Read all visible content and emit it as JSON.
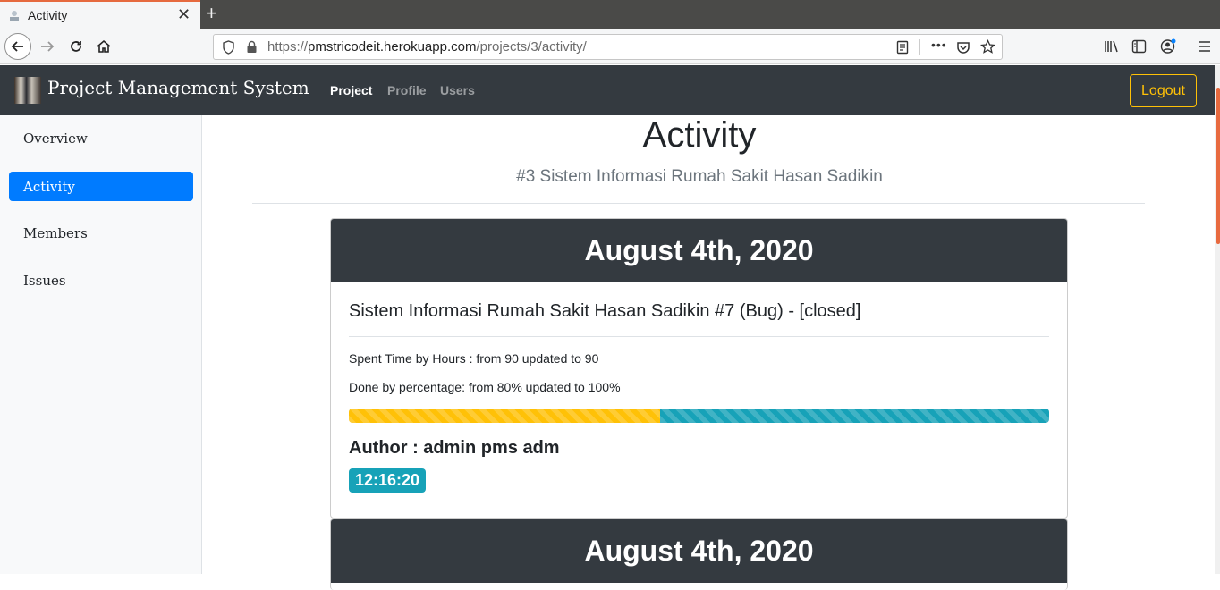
{
  "browser": {
    "tab_title": "Activity",
    "tab_close": "✕",
    "new_tab": "+",
    "url_scheme": "https://",
    "url_domain": "pmstricodeit.herokuapp.com",
    "url_path": "/projects/3/activity/",
    "page_actions": "•••"
  },
  "app": {
    "brand": "Project Management System",
    "nav": [
      {
        "label": "Project",
        "active": true
      },
      {
        "label": "Profile",
        "active": false
      },
      {
        "label": "Users",
        "active": false
      }
    ],
    "logout_label": "Logout"
  },
  "sidebar": {
    "items": [
      {
        "label": "Overview",
        "active": false
      },
      {
        "label": "Activity",
        "active": true
      },
      {
        "label": "Members",
        "active": false
      },
      {
        "label": "Issues",
        "active": false
      }
    ]
  },
  "main": {
    "title": "Activity",
    "subtitle": "#3 Sistem Informasi Rumah Sakit Hasan Sadikin",
    "entries": [
      {
        "date": "August 4th, 2020",
        "issue_title": "Sistem Informasi Rumah Sakit Hasan Sadikin #7 (Bug) - [closed]",
        "spent_time": "Spent Time by Hours : from 90 updated to 90",
        "done_pct": "Done by percentage: from 80% updated to 100%",
        "progress_old": 0.444,
        "progress_new": 0.556,
        "author": "Author : admin pms adm",
        "time": "12:16:20"
      },
      {
        "date": "August 4th, 2020"
      }
    ]
  },
  "colors": {
    "navbar": "#343a40",
    "accent": "#007bff",
    "warning": "#ffc107",
    "info": "#17a2b8"
  }
}
